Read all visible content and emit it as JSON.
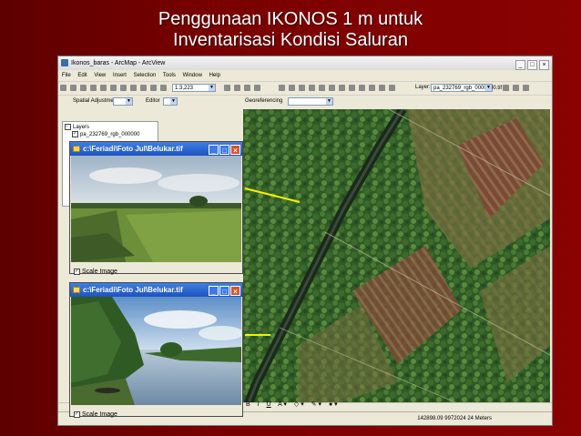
{
  "slide": {
    "title_line1": "Penggunaan IKONOS 1 m untuk",
    "title_line2": "Inventarisasi Kondisi Saluran"
  },
  "arcmap": {
    "window_title": "Ikonos_baras - ArcMap - ArcView",
    "menu": [
      "File",
      "Edit",
      "View",
      "Insert",
      "Selection",
      "Tools",
      "Window",
      "Help"
    ],
    "scale": "1:3,223",
    "layer_label": "Layer:",
    "layer_value": "pa_232769_rgb_0000000.tif",
    "editor_label": "Editor",
    "spatial_adjustment_label": "Spatial Adjustment",
    "georeferencing_label": "Georeferencing",
    "toc": {
      "root": "Layers",
      "layer": "pa_232769_rgb_000000"
    },
    "status_coords": "142898.09 9972024 24 Meters"
  },
  "photo_windows": [
    {
      "title": "c:\\Feriadi\\Foto Jul\\Belukar.tif",
      "scale_label": "Scale Image"
    },
    {
      "title": "c:\\Feriadi\\Foto Jul\\Belukar.tif",
      "scale_label": "Scale Image"
    }
  ],
  "window_buttons": {
    "minimize": "_",
    "maximize": "□",
    "close": "×"
  },
  "colors": {
    "slide_bg": "#7a0000",
    "arrow": "#f6f000",
    "photo_titlebar": "#1d52c2"
  }
}
